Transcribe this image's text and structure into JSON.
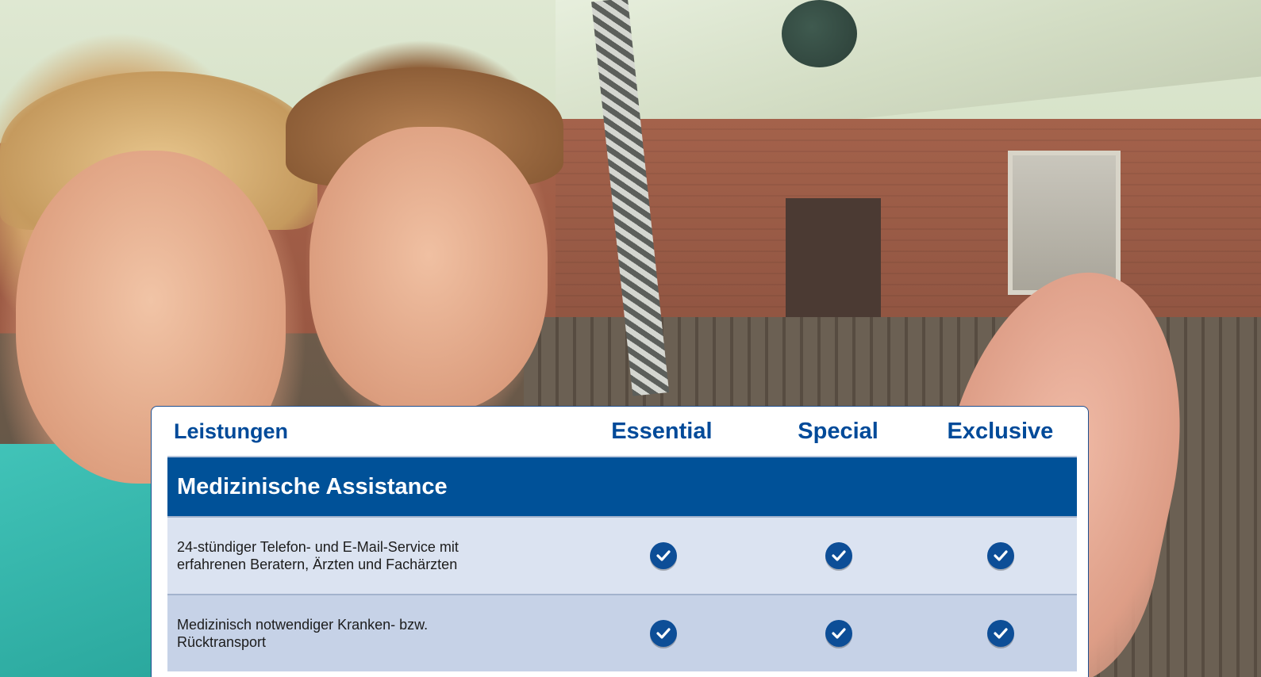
{
  "table": {
    "header": {
      "label": "Leistungen",
      "plans": [
        "Essential",
        "Special",
        "Exclusive"
      ]
    },
    "section_title": "Medizinische Assistance",
    "rows": [
      {
        "line1": "24-stündiger Telefon- und E-Mail-Service mit",
        "line2": "erfahrenen Beratern, Ärzten und Fachärzten",
        "included": [
          true,
          true,
          true
        ]
      },
      {
        "line1": "Medizinisch notwendiger Kranken- bzw.",
        "line2": "Rücktransport",
        "included": [
          true,
          true,
          true
        ]
      }
    ],
    "check_icon": "check-circle-icon",
    "colors": {
      "primary": "#005198",
      "header_text": "#004a99",
      "row_light": "#dbe3f1",
      "row_dark": "#c6d2e7"
    }
  }
}
